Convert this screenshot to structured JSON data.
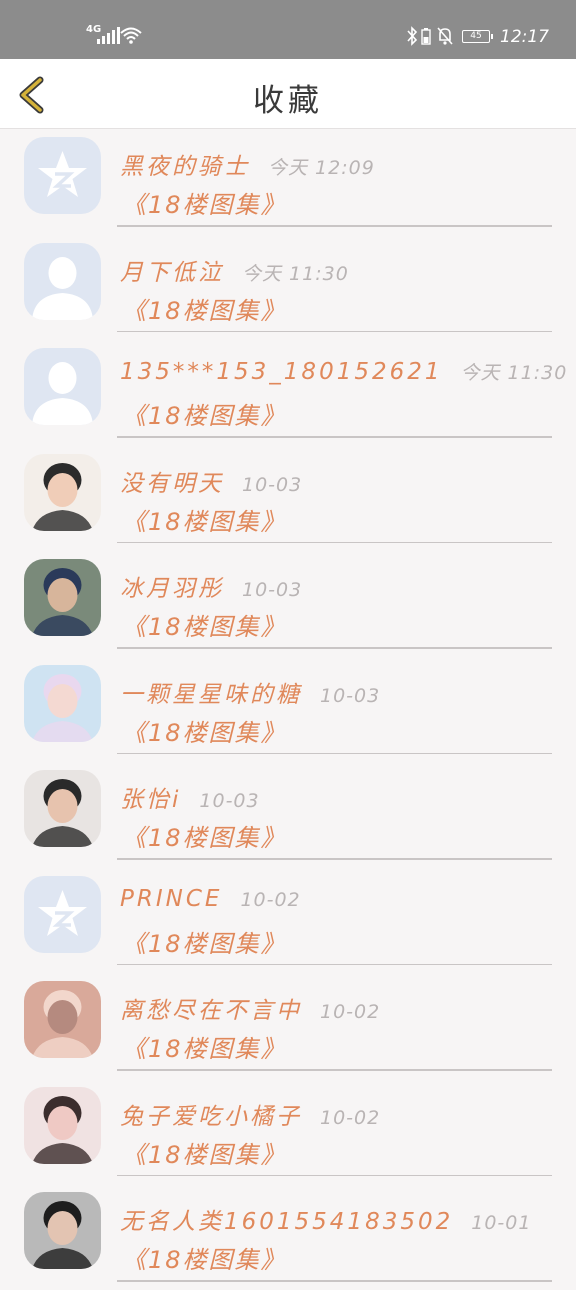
{
  "status_bar": {
    "network": "4G",
    "battery": "45",
    "time": "12:17"
  },
  "header": {
    "title": "收藏"
  },
  "icons": {
    "back": "chevron-left-icon",
    "qzone_avatar": "qzone-star-icon",
    "default_avatar": "default-person-icon"
  },
  "colors": {
    "accent": "#e0885a",
    "back_arrow": "#c9a227",
    "status_bar": "#8c8c8c",
    "avatar_placeholder": "#dfe6f2"
  },
  "favorites": [
    {
      "name": "黑夜的骑士",
      "time": "今天 12:09",
      "source": "《18楼图集》"
    },
    {
      "name": "月下低泣",
      "time": "今天 11:30",
      "source": "《18楼图集》"
    },
    {
      "name": "135***153_180152621",
      "time": "今天 11:30",
      "source": "《18楼图集》"
    },
    {
      "name": "没有明天",
      "time": "10-03",
      "source": "《18楼图集》"
    },
    {
      "name": "冰月羽彤",
      "time": "10-03",
      "source": "《18楼图集》"
    },
    {
      "name": "一颗星星味的糖",
      "time": "10-03",
      "source": "《18楼图集》"
    },
    {
      "name": "张怡i",
      "time": "10-03",
      "source": "《18楼图集》"
    },
    {
      "name": "PRINCE",
      "time": "10-02",
      "source": "《18楼图集》"
    },
    {
      "name": "离愁尽在不言中",
      "time": "10-02",
      "source": "《18楼图集》"
    },
    {
      "name": "兔子爱吃小橘子",
      "time": "10-02",
      "source": "《18楼图集》"
    },
    {
      "name": "无名人类1601554183502",
      "time": "10-01",
      "source": "《18楼图集》"
    }
  ]
}
